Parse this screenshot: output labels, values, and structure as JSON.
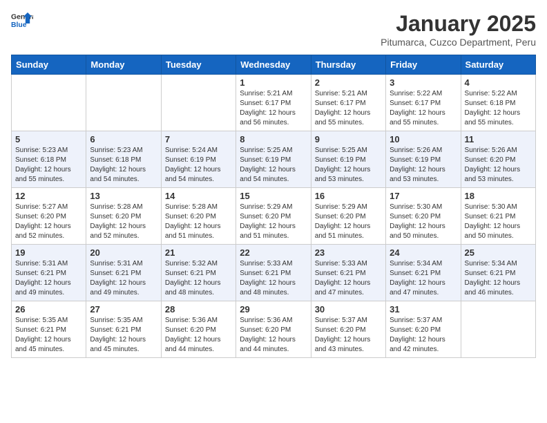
{
  "header": {
    "logo_general": "General",
    "logo_blue": "Blue",
    "month_title": "January 2025",
    "location": "Pitumarca, Cuzco Department, Peru"
  },
  "days_of_week": [
    "Sunday",
    "Monday",
    "Tuesday",
    "Wednesday",
    "Thursday",
    "Friday",
    "Saturday"
  ],
  "weeks": [
    [
      {
        "day": "",
        "info": ""
      },
      {
        "day": "",
        "info": ""
      },
      {
        "day": "",
        "info": ""
      },
      {
        "day": "1",
        "info": "Sunrise: 5:21 AM\nSunset: 6:17 PM\nDaylight: 12 hours\nand 56 minutes."
      },
      {
        "day": "2",
        "info": "Sunrise: 5:21 AM\nSunset: 6:17 PM\nDaylight: 12 hours\nand 55 minutes."
      },
      {
        "day": "3",
        "info": "Sunrise: 5:22 AM\nSunset: 6:17 PM\nDaylight: 12 hours\nand 55 minutes."
      },
      {
        "day": "4",
        "info": "Sunrise: 5:22 AM\nSunset: 6:18 PM\nDaylight: 12 hours\nand 55 minutes."
      }
    ],
    [
      {
        "day": "5",
        "info": "Sunrise: 5:23 AM\nSunset: 6:18 PM\nDaylight: 12 hours\nand 55 minutes."
      },
      {
        "day": "6",
        "info": "Sunrise: 5:23 AM\nSunset: 6:18 PM\nDaylight: 12 hours\nand 54 minutes."
      },
      {
        "day": "7",
        "info": "Sunrise: 5:24 AM\nSunset: 6:19 PM\nDaylight: 12 hours\nand 54 minutes."
      },
      {
        "day": "8",
        "info": "Sunrise: 5:25 AM\nSunset: 6:19 PM\nDaylight: 12 hours\nand 54 minutes."
      },
      {
        "day": "9",
        "info": "Sunrise: 5:25 AM\nSunset: 6:19 PM\nDaylight: 12 hours\nand 53 minutes."
      },
      {
        "day": "10",
        "info": "Sunrise: 5:26 AM\nSunset: 6:19 PM\nDaylight: 12 hours\nand 53 minutes."
      },
      {
        "day": "11",
        "info": "Sunrise: 5:26 AM\nSunset: 6:20 PM\nDaylight: 12 hours\nand 53 minutes."
      }
    ],
    [
      {
        "day": "12",
        "info": "Sunrise: 5:27 AM\nSunset: 6:20 PM\nDaylight: 12 hours\nand 52 minutes."
      },
      {
        "day": "13",
        "info": "Sunrise: 5:28 AM\nSunset: 6:20 PM\nDaylight: 12 hours\nand 52 minutes."
      },
      {
        "day": "14",
        "info": "Sunrise: 5:28 AM\nSunset: 6:20 PM\nDaylight: 12 hours\nand 51 minutes."
      },
      {
        "day": "15",
        "info": "Sunrise: 5:29 AM\nSunset: 6:20 PM\nDaylight: 12 hours\nand 51 minutes."
      },
      {
        "day": "16",
        "info": "Sunrise: 5:29 AM\nSunset: 6:20 PM\nDaylight: 12 hours\nand 51 minutes."
      },
      {
        "day": "17",
        "info": "Sunrise: 5:30 AM\nSunset: 6:20 PM\nDaylight: 12 hours\nand 50 minutes."
      },
      {
        "day": "18",
        "info": "Sunrise: 5:30 AM\nSunset: 6:21 PM\nDaylight: 12 hours\nand 50 minutes."
      }
    ],
    [
      {
        "day": "19",
        "info": "Sunrise: 5:31 AM\nSunset: 6:21 PM\nDaylight: 12 hours\nand 49 minutes."
      },
      {
        "day": "20",
        "info": "Sunrise: 5:31 AM\nSunset: 6:21 PM\nDaylight: 12 hours\nand 49 minutes."
      },
      {
        "day": "21",
        "info": "Sunrise: 5:32 AM\nSunset: 6:21 PM\nDaylight: 12 hours\nand 48 minutes."
      },
      {
        "day": "22",
        "info": "Sunrise: 5:33 AM\nSunset: 6:21 PM\nDaylight: 12 hours\nand 48 minutes."
      },
      {
        "day": "23",
        "info": "Sunrise: 5:33 AM\nSunset: 6:21 PM\nDaylight: 12 hours\nand 47 minutes."
      },
      {
        "day": "24",
        "info": "Sunrise: 5:34 AM\nSunset: 6:21 PM\nDaylight: 12 hours\nand 47 minutes."
      },
      {
        "day": "25",
        "info": "Sunrise: 5:34 AM\nSunset: 6:21 PM\nDaylight: 12 hours\nand 46 minutes."
      }
    ],
    [
      {
        "day": "26",
        "info": "Sunrise: 5:35 AM\nSunset: 6:21 PM\nDaylight: 12 hours\nand 45 minutes."
      },
      {
        "day": "27",
        "info": "Sunrise: 5:35 AM\nSunset: 6:21 PM\nDaylight: 12 hours\nand 45 minutes."
      },
      {
        "day": "28",
        "info": "Sunrise: 5:36 AM\nSunset: 6:20 PM\nDaylight: 12 hours\nand 44 minutes."
      },
      {
        "day": "29",
        "info": "Sunrise: 5:36 AM\nSunset: 6:20 PM\nDaylight: 12 hours\nand 44 minutes."
      },
      {
        "day": "30",
        "info": "Sunrise: 5:37 AM\nSunset: 6:20 PM\nDaylight: 12 hours\nand 43 minutes."
      },
      {
        "day": "31",
        "info": "Sunrise: 5:37 AM\nSunset: 6:20 PM\nDaylight: 12 hours\nand 42 minutes."
      },
      {
        "day": "",
        "info": ""
      }
    ]
  ]
}
